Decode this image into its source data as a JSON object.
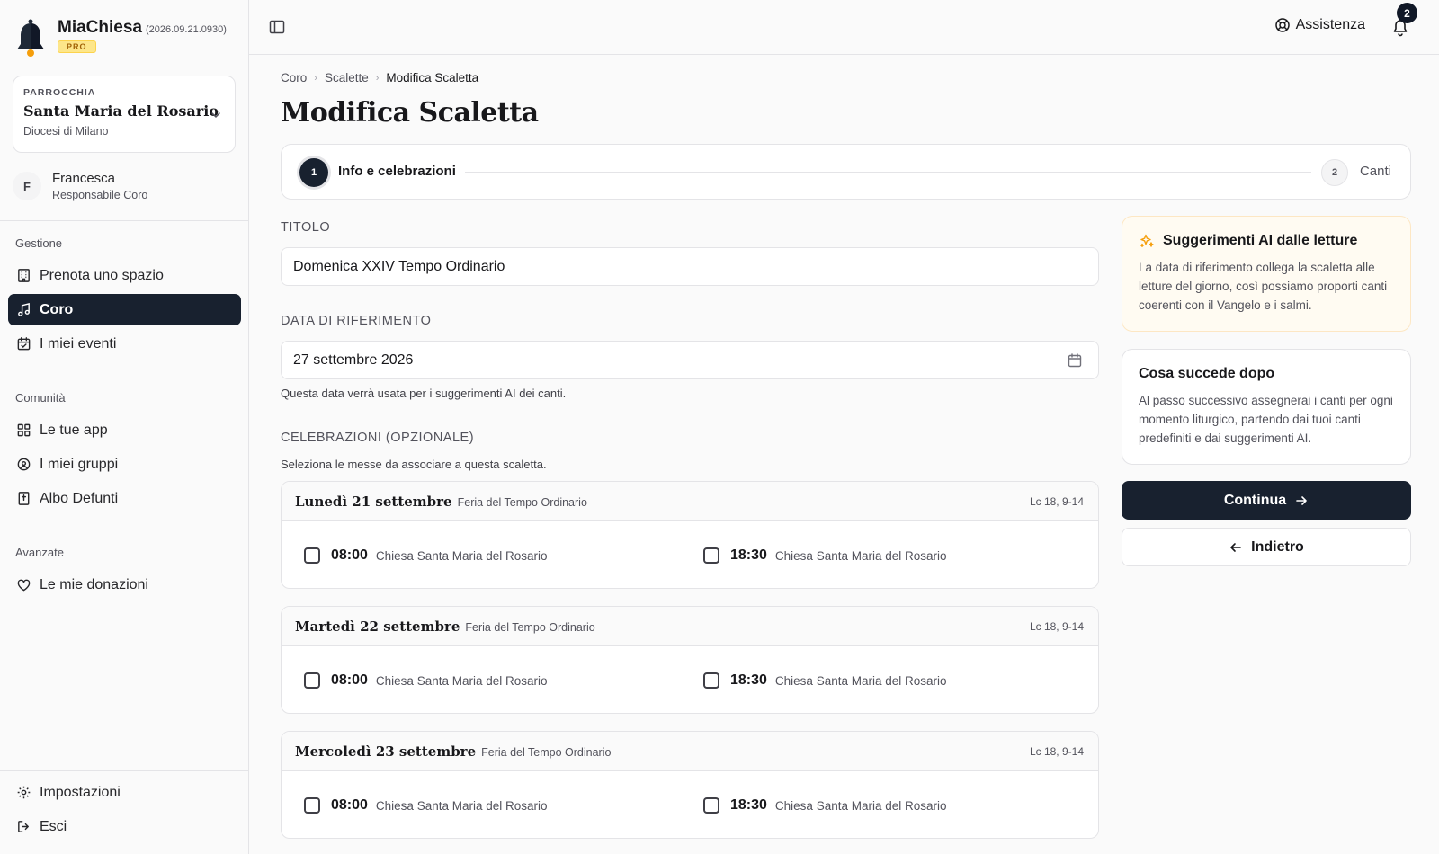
{
  "app": {
    "name": "MiaChiesa",
    "version": "(2026.09.21.0930)",
    "plan_badge": "PRO"
  },
  "parish": {
    "label": "PARROCCHIA",
    "name": "Santa Maria del Rosario",
    "diocese": "Diocesi di Milano"
  },
  "user": {
    "initial": "F",
    "name": "Francesca",
    "role": "Responsabile Coro"
  },
  "sidebar": {
    "sections": [
      {
        "label": "Gestione",
        "items": [
          {
            "label": "Prenota uno spazio",
            "icon": "building-icon"
          },
          {
            "label": "Coro",
            "icon": "music-note-icon",
            "active": true
          },
          {
            "label": "I miei eventi",
            "icon": "calendar-check-icon"
          }
        ]
      },
      {
        "label": "Comunità",
        "items": [
          {
            "label": "Le tue app",
            "icon": "grid-icon"
          },
          {
            "label": "I miei gruppi",
            "icon": "groups-icon"
          },
          {
            "label": "Albo Defunti",
            "icon": "memorial-book-icon"
          }
        ]
      },
      {
        "label": "Avanzate",
        "items": [
          {
            "label": "Le mie donazioni",
            "icon": "heart-icon"
          }
        ]
      }
    ],
    "footer": [
      {
        "label": "Impostazioni",
        "icon": "gear-icon"
      },
      {
        "label": "Esci",
        "icon": "logout-icon"
      }
    ]
  },
  "topbar": {
    "help_label": "Assistenza",
    "notifications_count": "2"
  },
  "breadcrumb": [
    "Coro",
    "Scalette",
    "Modifica Scaletta"
  ],
  "page": {
    "title": "Modifica Scaletta"
  },
  "stepper": {
    "steps": [
      {
        "number": "1",
        "label": "Info e celebrazioni",
        "active": true
      },
      {
        "number": "2",
        "label": "Canti",
        "active": false
      }
    ]
  },
  "form": {
    "title_label": "TITOLO",
    "title_value": "Domenica XXIV Tempo Ordinario",
    "date_label": "DATA DI RIFERIMENTO",
    "date_value": "27 settembre 2026",
    "date_help": "Questa data verrà usata per i suggerimenti AI dei canti.",
    "celebrations_label": "CELEBRAZIONI (OPZIONALE)",
    "celebrations_help": "Seleziona le messe da associare a questa scaletta."
  },
  "celebrations": [
    {
      "day": "Lunedì 21 settembre",
      "liturgy": "Feria del Tempo Ordinario",
      "reading": "Lc 18, 9-14",
      "masses": [
        {
          "time": "08:00",
          "place": "Chiesa Santa Maria del Rosario",
          "checked": false
        },
        {
          "time": "18:30",
          "place": "Chiesa Santa Maria del Rosario",
          "checked": false
        }
      ]
    },
    {
      "day": "Martedì 22 settembre",
      "liturgy": "Feria del Tempo Ordinario",
      "reading": "Lc 18, 9-14",
      "masses": [
        {
          "time": "08:00",
          "place": "Chiesa Santa Maria del Rosario",
          "checked": false
        },
        {
          "time": "18:30",
          "place": "Chiesa Santa Maria del Rosario",
          "checked": false
        }
      ]
    },
    {
      "day": "Mercoledì 23 settembre",
      "liturgy": "Feria del Tempo Ordinario",
      "reading": "Lc 18, 9-14",
      "masses": [
        {
          "time": "08:00",
          "place": "Chiesa Santa Maria del Rosario",
          "checked": false
        },
        {
          "time": "18:30",
          "place": "Chiesa Santa Maria del Rosario",
          "checked": false
        }
      ]
    }
  ],
  "ai_card": {
    "title": "Suggerimenti AI dalle letture",
    "text": "La data di riferimento collega la scaletta alle letture del giorno, così possiamo proporti canti coerenti con il Vangelo e i salmi."
  },
  "next_card": {
    "title": "Cosa succede dopo",
    "text": "Al passo successivo assegnerai i canti per ogni momento liturgico, partendo dai tuoi canti predefiniti e dai suggerimenti AI."
  },
  "actions": {
    "continue_label": "Continua",
    "back_label": "Indietro"
  },
  "colors": {
    "primary": "#18212f",
    "accent_warm": "#f59e0b",
    "border": "#e4e4e7"
  }
}
